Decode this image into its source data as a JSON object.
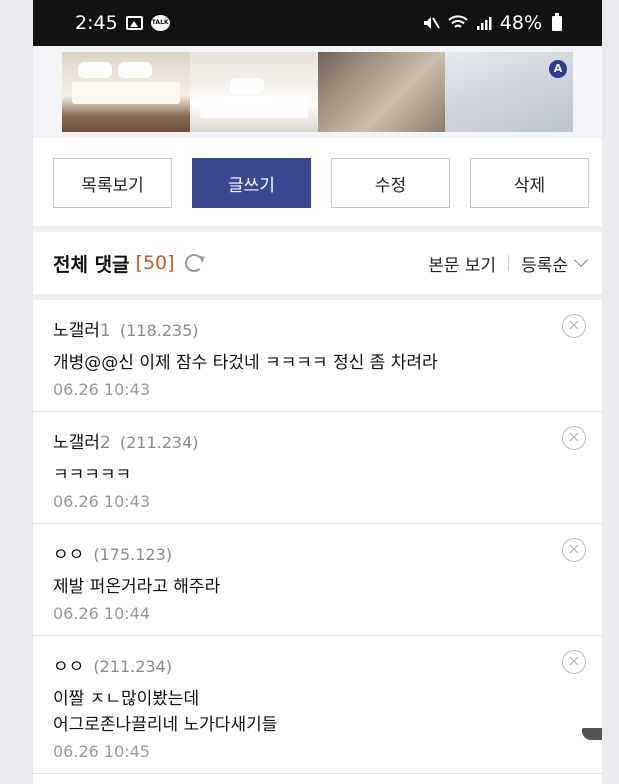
{
  "status_bar": {
    "time": "2:45",
    "icons": [
      "gallery-icon",
      "talk-icon",
      "mute-icon",
      "wifi-icon",
      "signal-icon",
      "battery-icon"
    ],
    "talk_label": "TALK",
    "battery": "48%"
  },
  "banner": {
    "images": [
      "bedding-image-1",
      "bedding-image-2",
      "bedding-image-3",
      "bedding-image-4"
    ],
    "badge": "A"
  },
  "actions": {
    "list": "목록보기",
    "write": "글쓰기",
    "edit": "수정",
    "delete": "삭제"
  },
  "comments_header": {
    "title": "전체 댓글",
    "count": "[50]",
    "view_post": "본문 보기",
    "sort": "등록순"
  },
  "comments": [
    {
      "author": "노갤러",
      "num": "1",
      "ip": "(118.235)",
      "body": [
        "개병@@신 이제 잠수 타겄네 ㅋㅋㅋㅋ 정신 좀 차려라"
      ],
      "date": "06.26 10:43"
    },
    {
      "author": "노갤러",
      "num": "2",
      "ip": "(211.234)",
      "body": [
        "ㅋㅋㅋㅋㅋ"
      ],
      "date": "06.26 10:43"
    },
    {
      "author": "ㅇㅇ",
      "num": "",
      "ip": "(175.123)",
      "body": [
        "제발 퍼온거라고 해주라"
      ],
      "date": "06.26 10:44"
    },
    {
      "author": "ㅇㅇ",
      "num": "",
      "ip": "(211.234)",
      "body": [
        "이짤 ㅈㄴ많이봤는데",
        "어그로존나끌리네 노가다새기들"
      ],
      "date": "06.26 10:45"
    }
  ],
  "colors": {
    "primary": "#3b4890",
    "count": "#c05a28",
    "statusbar": "#121212"
  }
}
